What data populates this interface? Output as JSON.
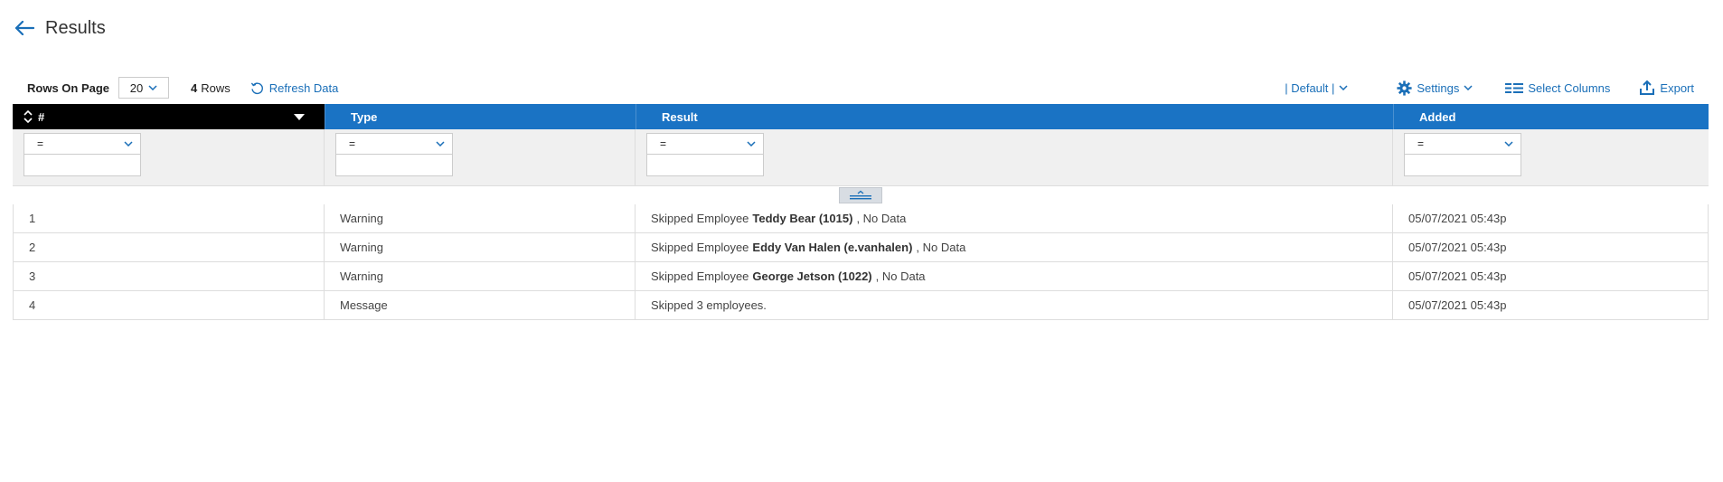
{
  "page": {
    "title": "Results"
  },
  "toolbar": {
    "rows_on_page_label": "Rows On Page",
    "rows_on_page_value": "20",
    "row_count": "4",
    "row_count_label": "Rows",
    "refresh_label": "Refresh Data",
    "view_label": "| Default |",
    "settings_label": "Settings",
    "select_columns_label": "Select Columns",
    "export_label": "Export"
  },
  "grid": {
    "columns": [
      {
        "label": "#"
      },
      {
        "label": "Type"
      },
      {
        "label": "Result"
      },
      {
        "label": "Added"
      }
    ],
    "filters": [
      {
        "operator": "=",
        "value": ""
      },
      {
        "operator": "=",
        "value": ""
      },
      {
        "operator": "=",
        "value": ""
      },
      {
        "operator": "=",
        "value": ""
      }
    ],
    "rows": [
      {
        "num": "1",
        "type": "Warning",
        "result_prefix": "Skipped Employee",
        "result_bold": "Teddy Bear (1015)",
        "result_suffix": ", No Data",
        "added": "05/07/2021 05:43p"
      },
      {
        "num": "2",
        "type": "Warning",
        "result_prefix": "Skipped Employee",
        "result_bold": "Eddy Van Halen (e.vanhalen)",
        "result_suffix": ", No Data",
        "added": "05/07/2021 05:43p"
      },
      {
        "num": "3",
        "type": "Warning",
        "result_prefix": "Skipped Employee",
        "result_bold": "George Jetson (1022)",
        "result_suffix": ", No Data",
        "added": "05/07/2021 05:43p"
      },
      {
        "num": "4",
        "type": "Message",
        "result_prefix": "Skipped 3 employees.",
        "result_bold": "",
        "result_suffix": "",
        "added": "05/07/2021 05:43p"
      }
    ]
  },
  "colors": {
    "accent": "#1a6fb8",
    "header_blue": "#1a73c4",
    "header_black": "#000000"
  }
}
